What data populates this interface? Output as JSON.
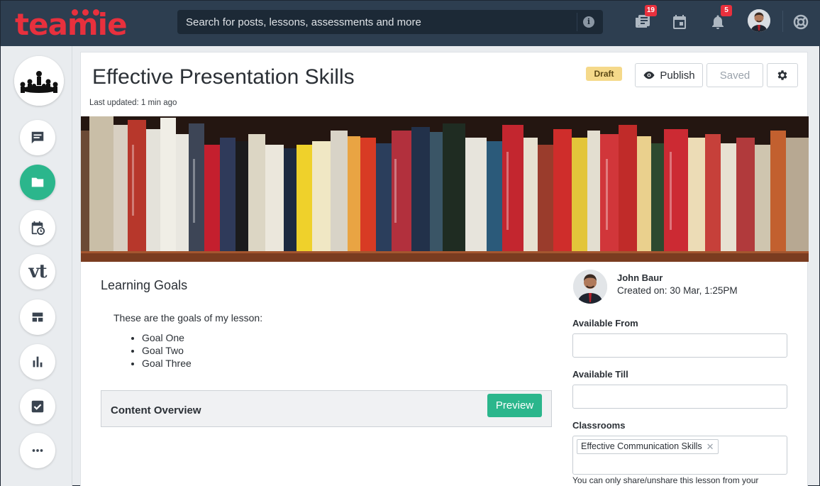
{
  "app": {
    "logo_text": "teamie",
    "brand_color": "#e8303d",
    "accent_color": "#2bb68c",
    "topbar_color": "#2d3e50"
  },
  "search": {
    "placeholder": "Search for posts, lessons, assessments and more",
    "info_icon": "info-icon"
  },
  "topbar": {
    "posts_badge": "19",
    "notifications_badge": "5",
    "icons": [
      "posts-icon",
      "calendar-icon",
      "bell-icon",
      "user-avatar",
      "help-lifebuoy-icon"
    ]
  },
  "sidebar": {
    "vt_label": "vt",
    "items": [
      {
        "name": "messages",
        "icon": "chat-icon"
      },
      {
        "name": "folders",
        "icon": "folder-icon",
        "active": true
      },
      {
        "name": "schedule",
        "icon": "calendar-clock-icon"
      },
      {
        "name": "vt",
        "icon": "vt-logo"
      },
      {
        "name": "dashboard",
        "icon": "dashboard-icon"
      },
      {
        "name": "analytics",
        "icon": "bar-chart-icon"
      },
      {
        "name": "tasks",
        "icon": "checkbox-icon"
      },
      {
        "name": "more",
        "icon": "more-icon"
      }
    ]
  },
  "lesson": {
    "title": "Effective Presentation Skills",
    "last_updated": "Last updated: 1 min ago",
    "status": "Draft",
    "publish_label": "Publish",
    "saved_label": "Saved"
  },
  "content": {
    "goals_title": "Learning Goals",
    "goals_intro": "These are the goals of my lesson:",
    "goals": [
      "Goal One",
      "Goal Two",
      "Goal Three"
    ],
    "overview_title": "Content Overview",
    "preview_label": "Preview"
  },
  "details": {
    "author_name": "John Baur",
    "created_on": "Created on: 30 Mar, 1:25PM",
    "available_from_label": "Available From",
    "available_from_value": "",
    "available_till_label": "Available Till",
    "available_till_value": "",
    "classrooms_label": "Classrooms",
    "classroom_chip": "Effective Communication Skills",
    "share_note": "You can only share/unshare this lesson from your"
  }
}
